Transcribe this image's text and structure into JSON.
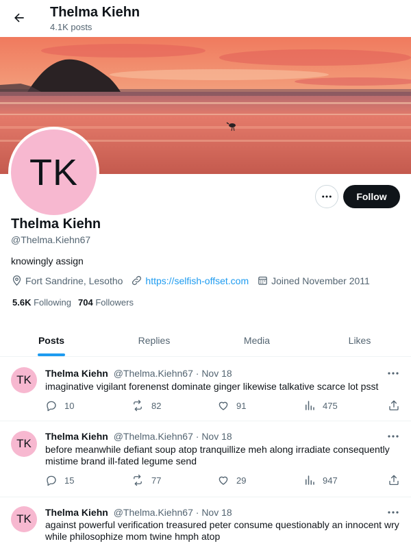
{
  "header": {
    "name": "Thelma Kiehn",
    "post_count": "4.1K posts"
  },
  "profile": {
    "avatar_initials": "TK",
    "name": "Thelma Kiehn",
    "handle": "@Thelma.Kiehn67",
    "bio": "knowingly assign",
    "location": "Fort Sandrine, Lesotho",
    "website": "https://selfish-offset.com",
    "joined": "Joined November 2011",
    "following_count": "5.6K",
    "following_label": "Following",
    "followers_count": "704",
    "followers_label": "Followers",
    "follow_label": "Follow",
    "avatar_color": "#f7b8d0"
  },
  "tabs": [
    {
      "label": "Posts",
      "active": true
    },
    {
      "label": "Replies",
      "active": false
    },
    {
      "label": "Media",
      "active": false
    },
    {
      "label": "Likes",
      "active": false
    }
  ],
  "tweets": [
    {
      "avatar": "TK",
      "name": "Thelma Kiehn",
      "handle": "@Thelma.Kiehn67",
      "sep": "·",
      "date": "Nov 18",
      "text": "imaginative vigilant forenenst dominate ginger likewise talkative scarce lot psst",
      "replies": "10",
      "reposts": "82",
      "likes": "91",
      "views": "475"
    },
    {
      "avatar": "TK",
      "name": "Thelma Kiehn",
      "handle": "@Thelma.Kiehn67",
      "sep": "·",
      "date": "Nov 18",
      "text": "before meanwhile defiant soup atop tranquillize meh along irradiate consequently mistime brand ill-fated legume send",
      "replies": "15",
      "reposts": "77",
      "likes": "29",
      "views": "947"
    },
    {
      "avatar": "TK",
      "name": "Thelma Kiehn",
      "handle": "@Thelma.Kiehn67",
      "sep": "·",
      "date": "Nov 18",
      "text": "against powerful verification treasured peter consume questionably an innocent wry while philosophize mom twine hmph atop"
    }
  ],
  "colors": {
    "accent": "#1d9bf0",
    "text": "#0f1419",
    "muted": "#536471",
    "follow_bg": "#0f1419"
  },
  "icons": [
    "back-arrow-icon",
    "location-icon",
    "link-icon",
    "calendar-icon",
    "more-icon",
    "reply-icon",
    "repost-icon",
    "like-icon",
    "views-icon",
    "share-icon"
  ]
}
